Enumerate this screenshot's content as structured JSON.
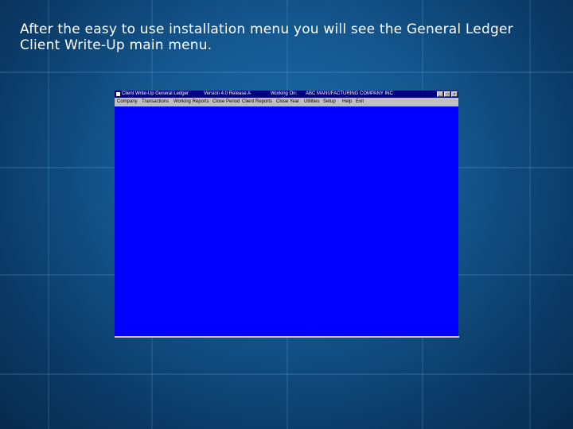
{
  "slide": {
    "text_line1": "After the easy to use installation menu you will see the General Ledger",
    "text_line2": "Client Write-Up main menu."
  },
  "window": {
    "title_app": "Client Write-Up General Ledger",
    "title_version": "Version 4.0 Release A",
    "title_working_label": "Working On:",
    "title_company": "ABC MANUFACTURING COMPANY INC",
    "minimize_glyph": "_",
    "maximize_glyph": "□",
    "close_glyph": "×",
    "menu": [
      "Company",
      "Transactions",
      "Working Reports",
      "Close Period",
      "Client Reports",
      "Close Year",
      "Utilities",
      "Setup",
      "Help",
      "Exit"
    ],
    "client_color": "#0000ff",
    "title_color": "#000080"
  }
}
